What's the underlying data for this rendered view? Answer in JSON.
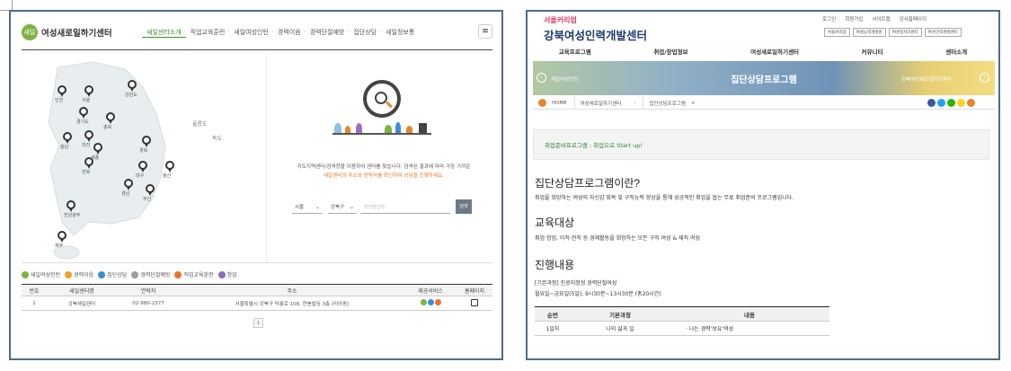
{
  "left": {
    "logo": {
      "mark": "새일",
      "text": "여성새로일하기센터"
    },
    "nav": [
      {
        "label": "새일센터소개",
        "active": true
      },
      {
        "label": "직업교육훈련",
        "active": false
      },
      {
        "label": "새일여성인턴",
        "active": false
      },
      {
        "label": "경력이음",
        "active": false
      },
      {
        "label": "경력단절예방",
        "active": false
      },
      {
        "label": "집단상담",
        "active": false
      },
      {
        "label": "새일정보통",
        "active": false
      }
    ],
    "menu_icon": "≡",
    "map": {
      "regions": [
        "인천",
        "서울",
        "강원도",
        "경기도",
        "충북",
        "충남",
        "대전",
        "세종",
        "경북",
        "전북",
        "대구",
        "울산",
        "경남",
        "부산",
        "전남광주",
        "제주"
      ],
      "islands": [
        "울릉도",
        "독도"
      ]
    },
    "search": {
      "info_line1": "지도지역센터/검색창을 이용하여 센터를 찾습니다. 검색된 결과에 따라 가장 가까운",
      "info_line2": "새일센터의 주소와 연락처를 확인하여 상담을 진행하세요.",
      "select_city": "서울",
      "select_district": "강북구",
      "placeholder": "센터명입력",
      "button": "검색"
    },
    "legend": [
      {
        "label": "새일여성인턴",
        "color": "#7cb342"
      },
      {
        "label": "경력이음",
        "color": "#f0a22e"
      },
      {
        "label": "집단상담",
        "color": "#3b8ed6"
      },
      {
        "label": "경력단절예방",
        "color": "#9e9e9e"
      },
      {
        "label": "직업교육훈련",
        "color": "#e8732b"
      },
      {
        "label": "창업",
        "color": "#8e6bbf"
      }
    ],
    "table": {
      "headers": [
        "번호",
        "새일센터명",
        "연락처",
        "주소",
        "제공서비스",
        "홈페이지"
      ],
      "rows": [
        {
          "no": "1",
          "name": "강북새일센터",
          "phone": "02-980-2377",
          "address": "서울특별시 강북구 덕릉로 108, 현봉빌딩 3층 (미아동)",
          "services": [
            "#7cb342",
            "#3b8ed6",
            "#e8732b"
          ]
        }
      ]
    },
    "page": "1"
  },
  "right": {
    "logo_small": "서울커리업",
    "logo_title": "강북여성인력개발센터",
    "util": [
      "로그인",
      "회원가입",
      "사이트맵",
      "강사홈페이지"
    ],
    "quick": [
      "서울커리업",
      "여성능력개발원",
      "여성일자리센터",
      "여성인력개발센터"
    ],
    "nav": [
      "교육프로그램",
      "취업/창업정보",
      "여성새로일하기센터",
      "커뮤니티",
      "센터소개"
    ],
    "banner": {
      "title": "집단상담프로그램",
      "left": "새일여성인턴",
      "right": "강북여성새로일하기센터"
    },
    "breadcrumb": [
      "HOME",
      "여성새로일하기센터",
      "집단상담프로그램",
      "+"
    ],
    "social_colors": [
      "#3b5998",
      "#1da1f2",
      "#2db400",
      "#f9d71c",
      "#e6862b"
    ],
    "notice": "취업준비프로그램 : 취업으로 Start up!",
    "sections": [
      {
        "title": "집단상담프로그램이란?",
        "text": "취업을 희망하는 여성의 자신감 회복 및 구직능력 향상을 통해 성공적인 취업을 돕는 무료 취업준비 프로그램입니다."
      },
      {
        "title": "교육대상",
        "text": "취업·창업, 이직·전직 등 경제활동을 희망하는 모든 구직 여성 & 재직 여성"
      },
      {
        "title": "진행내용",
        "text": "[기본과정] 진로미정형 경력단절여성",
        "text2": "월요일~금요일(5일), 9시30분~13시30분 (총20시간)"
      }
    ],
    "table": {
      "headers": [
        "순번",
        "기본과정",
        "내용"
      ],
      "rows": [
        [
          "1일차",
          "나의 삶과 일",
          "· 나는 경력'보유'여성"
        ]
      ]
    }
  }
}
